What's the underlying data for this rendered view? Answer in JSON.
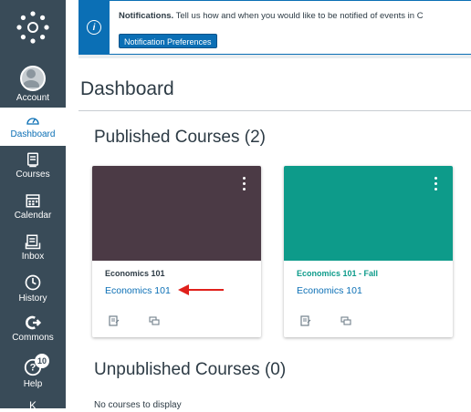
{
  "nav": {
    "items": [
      {
        "label": "Account",
        "icon": "account-avatar"
      },
      {
        "label": "Dashboard",
        "icon": "dashboard-icon"
      },
      {
        "label": "Courses",
        "icon": "courses-icon"
      },
      {
        "label": "Calendar",
        "icon": "calendar-icon"
      },
      {
        "label": "Inbox",
        "icon": "inbox-icon"
      },
      {
        "label": "History",
        "icon": "history-icon"
      },
      {
        "label": "Commons",
        "icon": "commons-icon"
      },
      {
        "label": "Help",
        "icon": "help-icon",
        "badge": "10"
      }
    ],
    "more_glyph": "K"
  },
  "banner": {
    "bold": "Notifications.",
    "text": " Tell us how and when you would like to be notified of events in C",
    "button": "Notification Preferences"
  },
  "page": {
    "title": "Dashboard",
    "published_heading": "Published Courses (2)",
    "unpublished_heading": "Unpublished Courses (0)",
    "empty_note": "No courses to display"
  },
  "cards": [
    {
      "title": "Economics 101",
      "subtitle": "Economics 101",
      "color": "#4b3a45",
      "title_color": "#2d3b45"
    },
    {
      "title": "Economics 101 - Fall",
      "subtitle": "Economics 101",
      "color": "#0d9b8a",
      "title_color": "#0d9b8a"
    }
  ],
  "colors": {
    "nav": "#394b58",
    "brand": "#0b6fb5",
    "arrow": "#e0201b"
  }
}
